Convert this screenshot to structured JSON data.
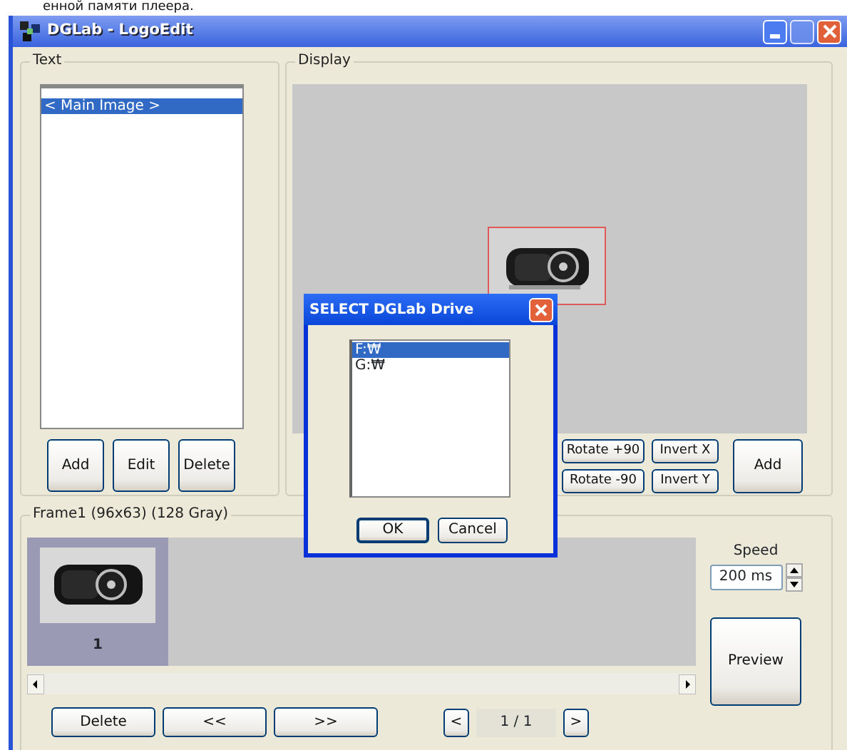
{
  "page_caption": "енной памяти плеера.",
  "window": {
    "title": "DGLab - LogoEdit"
  },
  "text_group": {
    "title": "Text",
    "items": [
      {
        "label": "< Main Image >",
        "selected": true
      }
    ],
    "buttons": [
      "Add",
      "Edit",
      "Delete"
    ]
  },
  "display_group": {
    "title": "Display",
    "transform_buttons": [
      "Rotate +90",
      "Invert X",
      "Rotate -90",
      "Invert Y"
    ],
    "add_button": "Add"
  },
  "frames_group": {
    "title": "Frame1 (96x63)  (128 Gray)",
    "frames": [
      {
        "label": "1",
        "selected": true
      }
    ],
    "speed_label": "Speed",
    "speed_value": "200 ms",
    "preview_button": "Preview",
    "buttons": [
      "Delete",
      "<<",
      ">>"
    ],
    "prev_page": "<",
    "page": "1 / 1",
    "next_page": ">"
  },
  "dialog": {
    "title": "SELECT DGLab Drive",
    "drives": [
      {
        "label": "F:₩",
        "selected": true
      },
      {
        "label": "G:₩",
        "selected": false
      }
    ],
    "buttons": [
      "OK",
      "Cancel"
    ]
  }
}
